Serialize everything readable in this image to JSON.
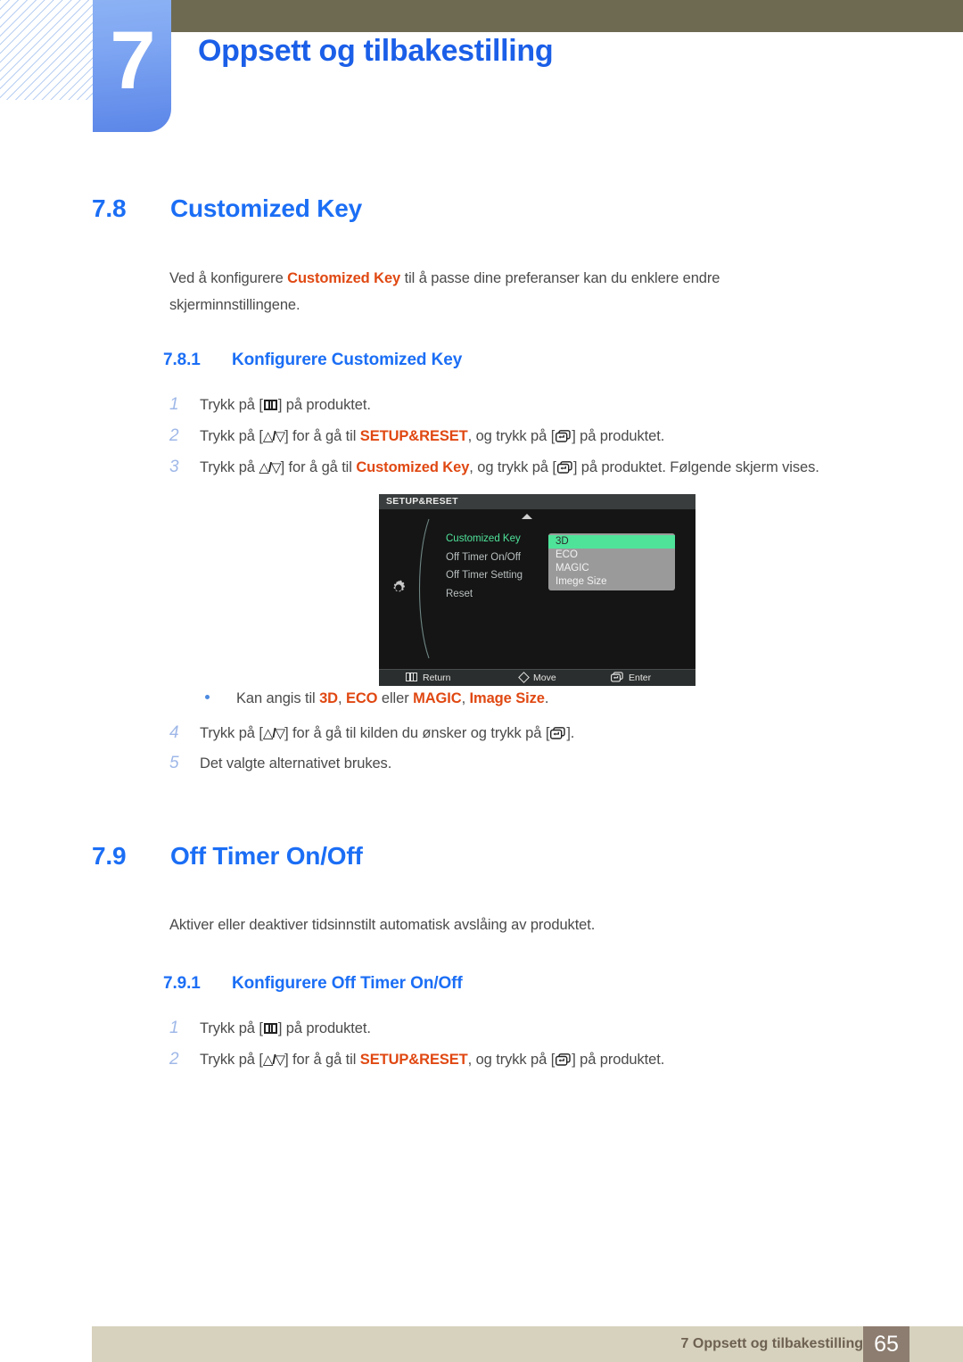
{
  "header": {
    "chapter_number": "7",
    "chapter_title": "Oppsett og tilbakestilling"
  },
  "sections": [
    {
      "number": "7.8",
      "title": "Customized Key",
      "intro_part1": "Ved å konfigurere ",
      "intro_accent": "Customized Key",
      "intro_part2": " til å passe dine preferanser kan du enklere endre",
      "intro_line2": "skjerminnstillingene."
    },
    {
      "number": "7.9",
      "title": "Off Timer On/Off",
      "intro": "Aktiver eller deaktiver tidsinnstilt automatisk avslåing av produktet."
    }
  ],
  "subsections": [
    {
      "number": "7.8.1",
      "title": "Konfigurere Customized Key"
    },
    {
      "number": "7.9.1",
      "title": "Konfigurere Off Timer On/Off"
    }
  ],
  "steps_781": [
    {
      "n": "1",
      "t1": "Trykk på [",
      "icon1": "menu-key-icon",
      "t2": "] på produktet.",
      "t3": "",
      "accent": "",
      "icon2": "",
      "t4": ""
    },
    {
      "n": "2",
      "t1": "Trykk på [",
      "icon1": "up-down-key-icon",
      "t2": "] for å gå til ",
      "accent": "SETUP&RESET",
      "t3": ", og trykk på [",
      "icon2": "enter-key-icon",
      "t4": "] på produktet."
    },
    {
      "n": "3",
      "t1": "Trykk på ",
      "icon1": "up-down-key-icon",
      "t2": "] for å gå til ",
      "accent": "Customized Key",
      "t3": ", og trykk på [",
      "icon2": "enter-key-icon",
      "t4": "] på produktet. Følgende skjerm vises."
    },
    {
      "n": "4",
      "t1": "Trykk på [",
      "icon1": "up-down-key-icon",
      "t2": "] for å gå til kilden du ønsker og trykk på [",
      "accent": "",
      "t3": "",
      "icon2": "enter-key-icon",
      "t4": "]."
    },
    {
      "n": "5",
      "t1": "Det valgte alternativet brukes.",
      "icon1": "",
      "t2": "",
      "accent": "",
      "t3": "",
      "icon2": "",
      "t4": ""
    }
  ],
  "steps_791": [
    {
      "n": "1",
      "t1": "Trykk på [",
      "icon1": "menu-key-icon",
      "t2": "] på produktet.",
      "accent": "",
      "t3": "",
      "icon2": "",
      "t4": ""
    },
    {
      "n": "2",
      "t1": "Trykk på [",
      "icon1": "up-down-key-icon",
      "t2": "] for å gå til ",
      "accent": "SETUP&RESET",
      "t3": ", og trykk på [",
      "icon2": "enter-key-icon",
      "t4": "] på produktet."
    }
  ],
  "bullet": {
    "prefix": "Kan angis til ",
    "opt1": "3D",
    "sep1": ", ",
    "opt2": "ECO",
    "mid": " eller ",
    "opt3": "MAGIC",
    "sep2": ", ",
    "opt4": "Image Size",
    "suffix": "."
  },
  "osd": {
    "title": "SETUP&RESET",
    "items": [
      {
        "label": "Customized Key",
        "selected": true
      },
      {
        "label": "Off Timer On/Off",
        "selected": false
      },
      {
        "label": "Off Timer Setting",
        "selected": false
      },
      {
        "label": "Reset",
        "selected": false
      }
    ],
    "colon": ":",
    "submenu": [
      {
        "label": "3D",
        "highlighted": true
      },
      {
        "label": "ECO",
        "highlighted": false
      },
      {
        "label": "MAGIC",
        "highlighted": false
      },
      {
        "label": "Imege Size",
        "highlighted": false
      }
    ],
    "footer": {
      "return": "Return",
      "move": "Move",
      "enter": "Enter"
    },
    "colors": {
      "background": "#151515",
      "titlebar": "#3a3d3b",
      "selected_text": "#4fe39a",
      "highlight": "#4fe39a",
      "submenu_bg": "#9a9a9a"
    }
  },
  "footer": {
    "text": "7 Oppsett og tilbakestilling",
    "page": "65"
  },
  "colors": {
    "heading_blue": "#1b6ef5",
    "accent_orange": "#e04812",
    "olive": "#6e6a52",
    "footer_beige": "#d7d2bd",
    "footer_page_box": "#8d7d70",
    "step_number_blue": "#9fb8e8"
  }
}
